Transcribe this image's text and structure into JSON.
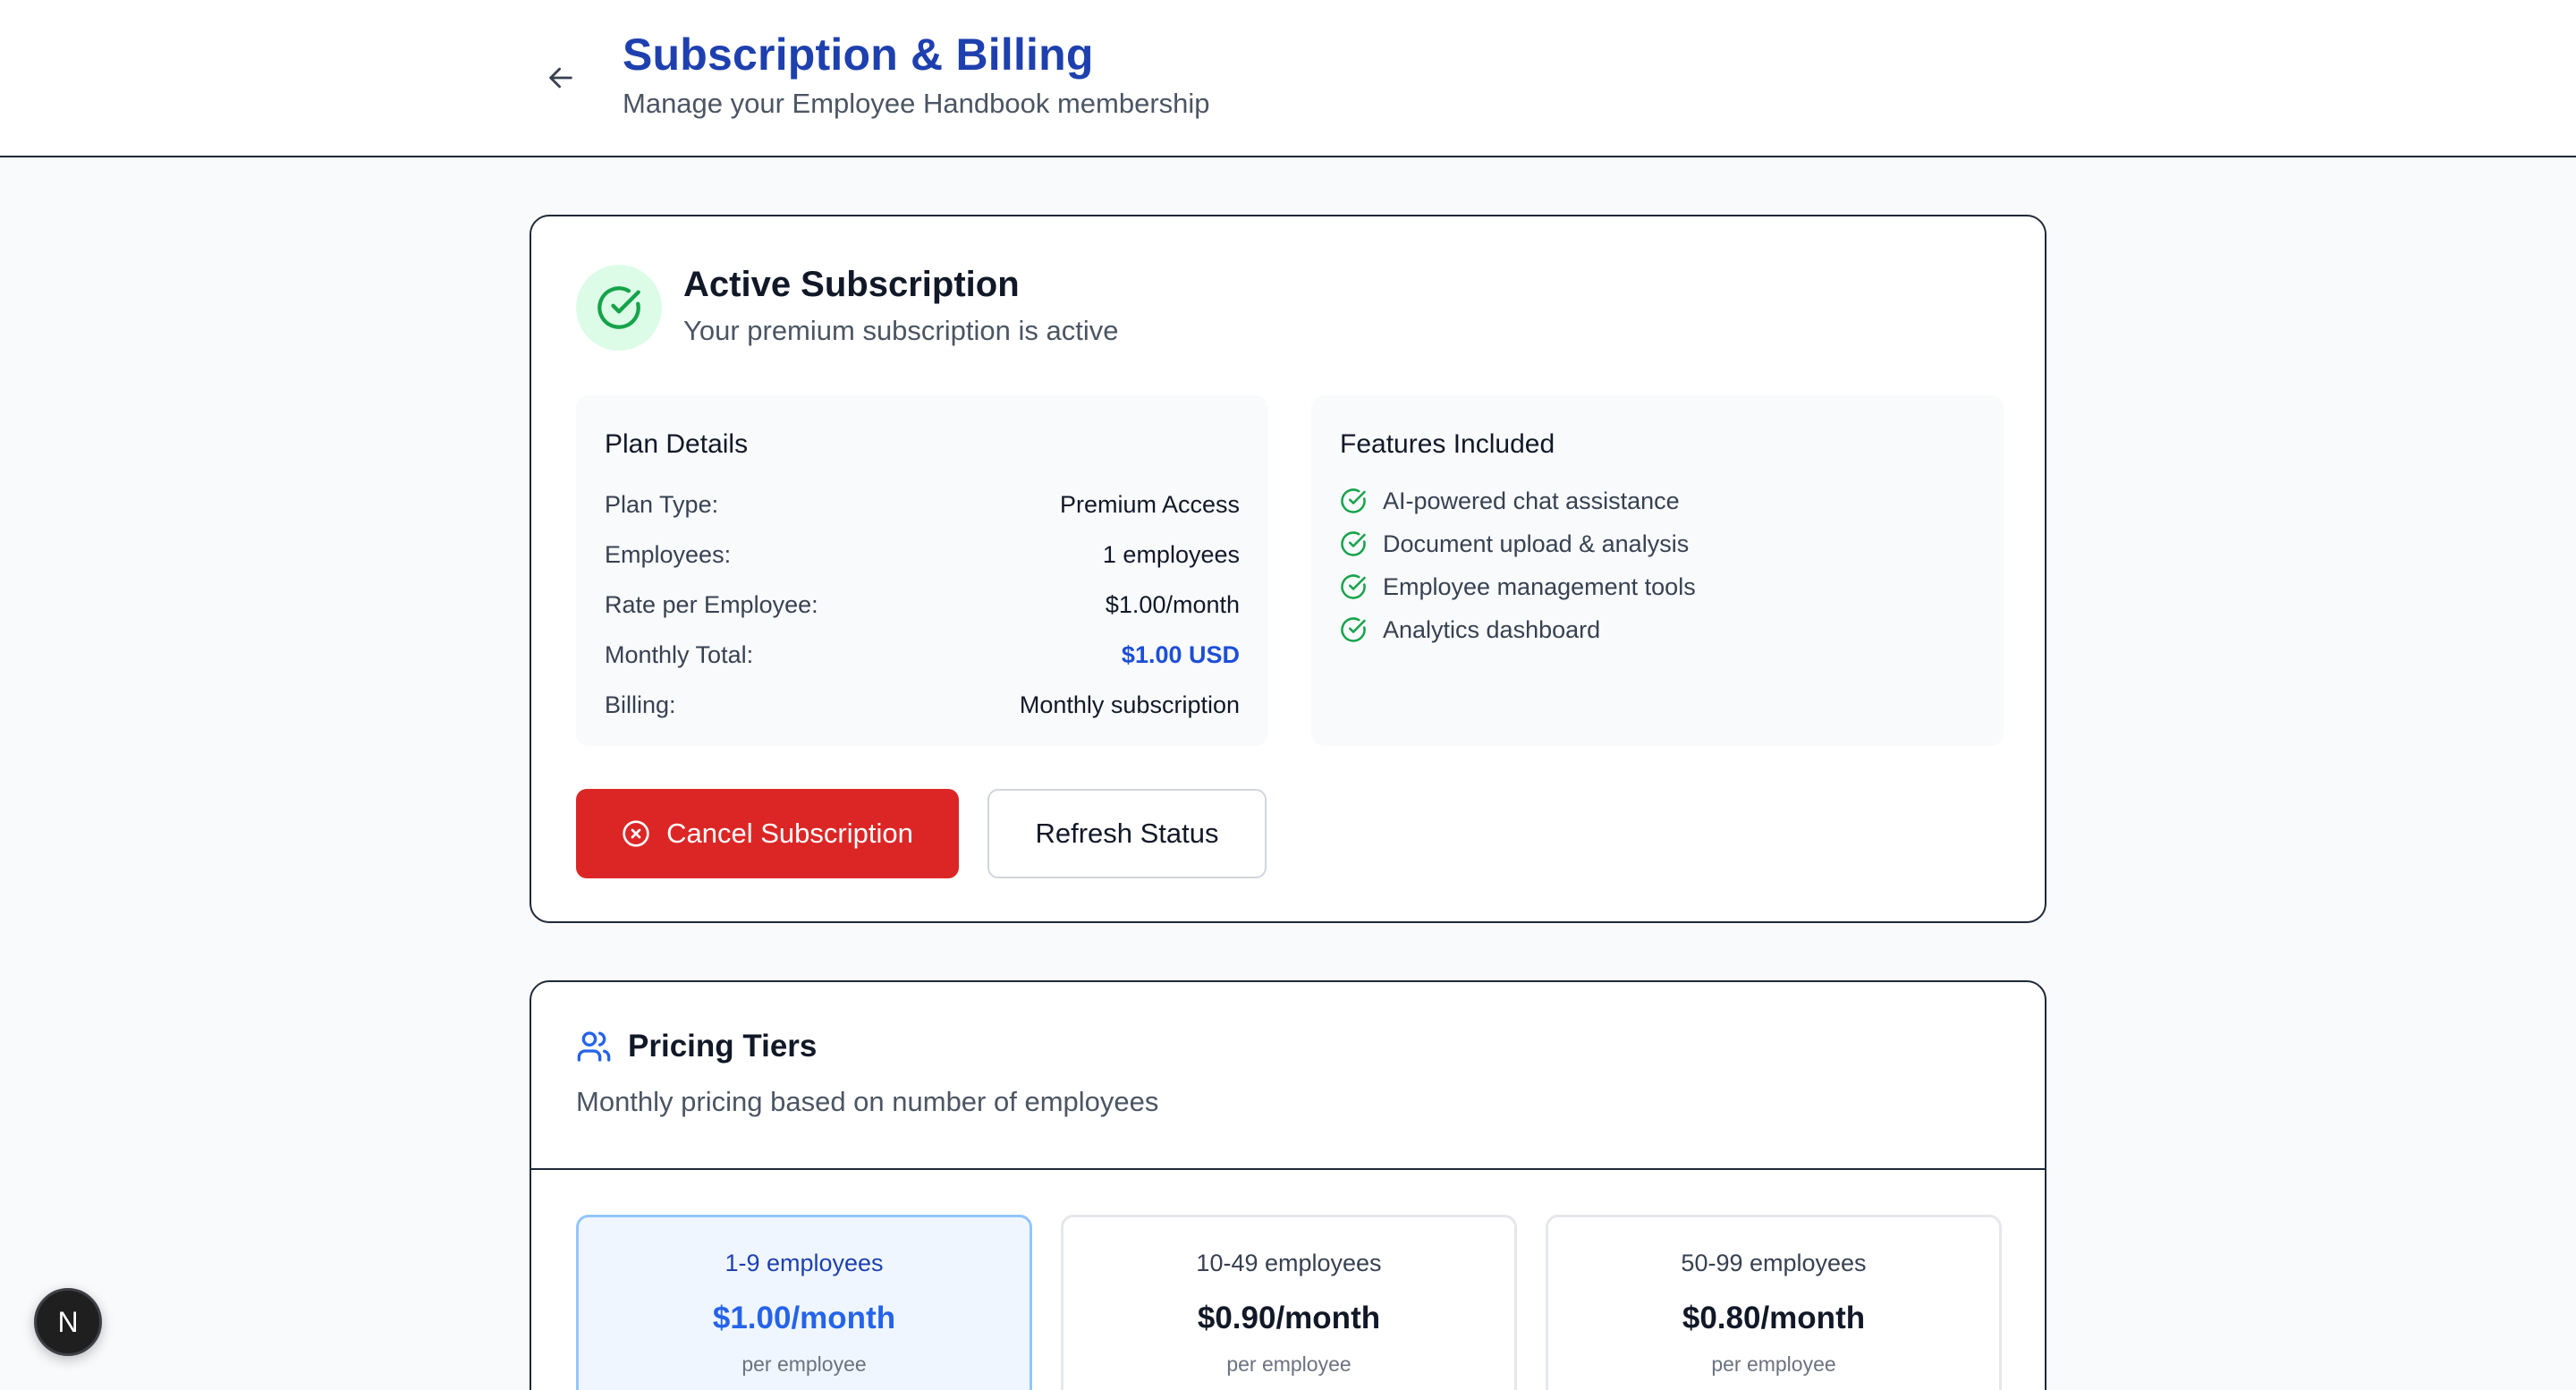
{
  "header": {
    "back_icon": "arrow-left-icon",
    "title": "Subscription & Billing",
    "subtitle": "Manage your Employee Handbook membership"
  },
  "active_subscription": {
    "icon": "check-circle-icon",
    "title": "Active Subscription",
    "subtitle": "Your premium subscription is active",
    "plan_details": {
      "heading": "Plan Details",
      "rows": [
        {
          "label": "Plan Type:",
          "value": "Premium Access"
        },
        {
          "label": "Employees:",
          "value": "1 employees"
        },
        {
          "label": "Rate per Employee:",
          "value": "$1.00/month"
        },
        {
          "label": "Monthly Total:",
          "value": "$1.00 USD"
        },
        {
          "label": "Billing:",
          "value": "Monthly subscription"
        }
      ]
    },
    "features": {
      "heading": "Features Included",
      "items": [
        "AI-powered chat assistance",
        "Document upload & analysis",
        "Employee management tools",
        "Analytics dashboard"
      ]
    },
    "cancel_button": "Cancel Subscription",
    "refresh_button": "Refresh Status"
  },
  "pricing": {
    "icon": "users-icon",
    "title": "Pricing Tiers",
    "subtitle": "Monthly pricing based on number of employees",
    "tiers": [
      {
        "range": "1-9 employees",
        "price": "$1.00/month",
        "unit": "per employee",
        "selected": true
      },
      {
        "range": "10-49 employees",
        "price": "$0.90/month",
        "unit": "per employee",
        "selected": false
      },
      {
        "range": "50-99 employees",
        "price": "$0.80/month",
        "unit": "per employee",
        "selected": false
      }
    ]
  },
  "dev_badge": {
    "label": "N"
  },
  "colors": {
    "brand_blue": "#1e40af",
    "accent_blue": "#2563eb",
    "success_green": "#16a34a",
    "danger_red": "#dc2626",
    "page_bg": "#f8fafc"
  }
}
